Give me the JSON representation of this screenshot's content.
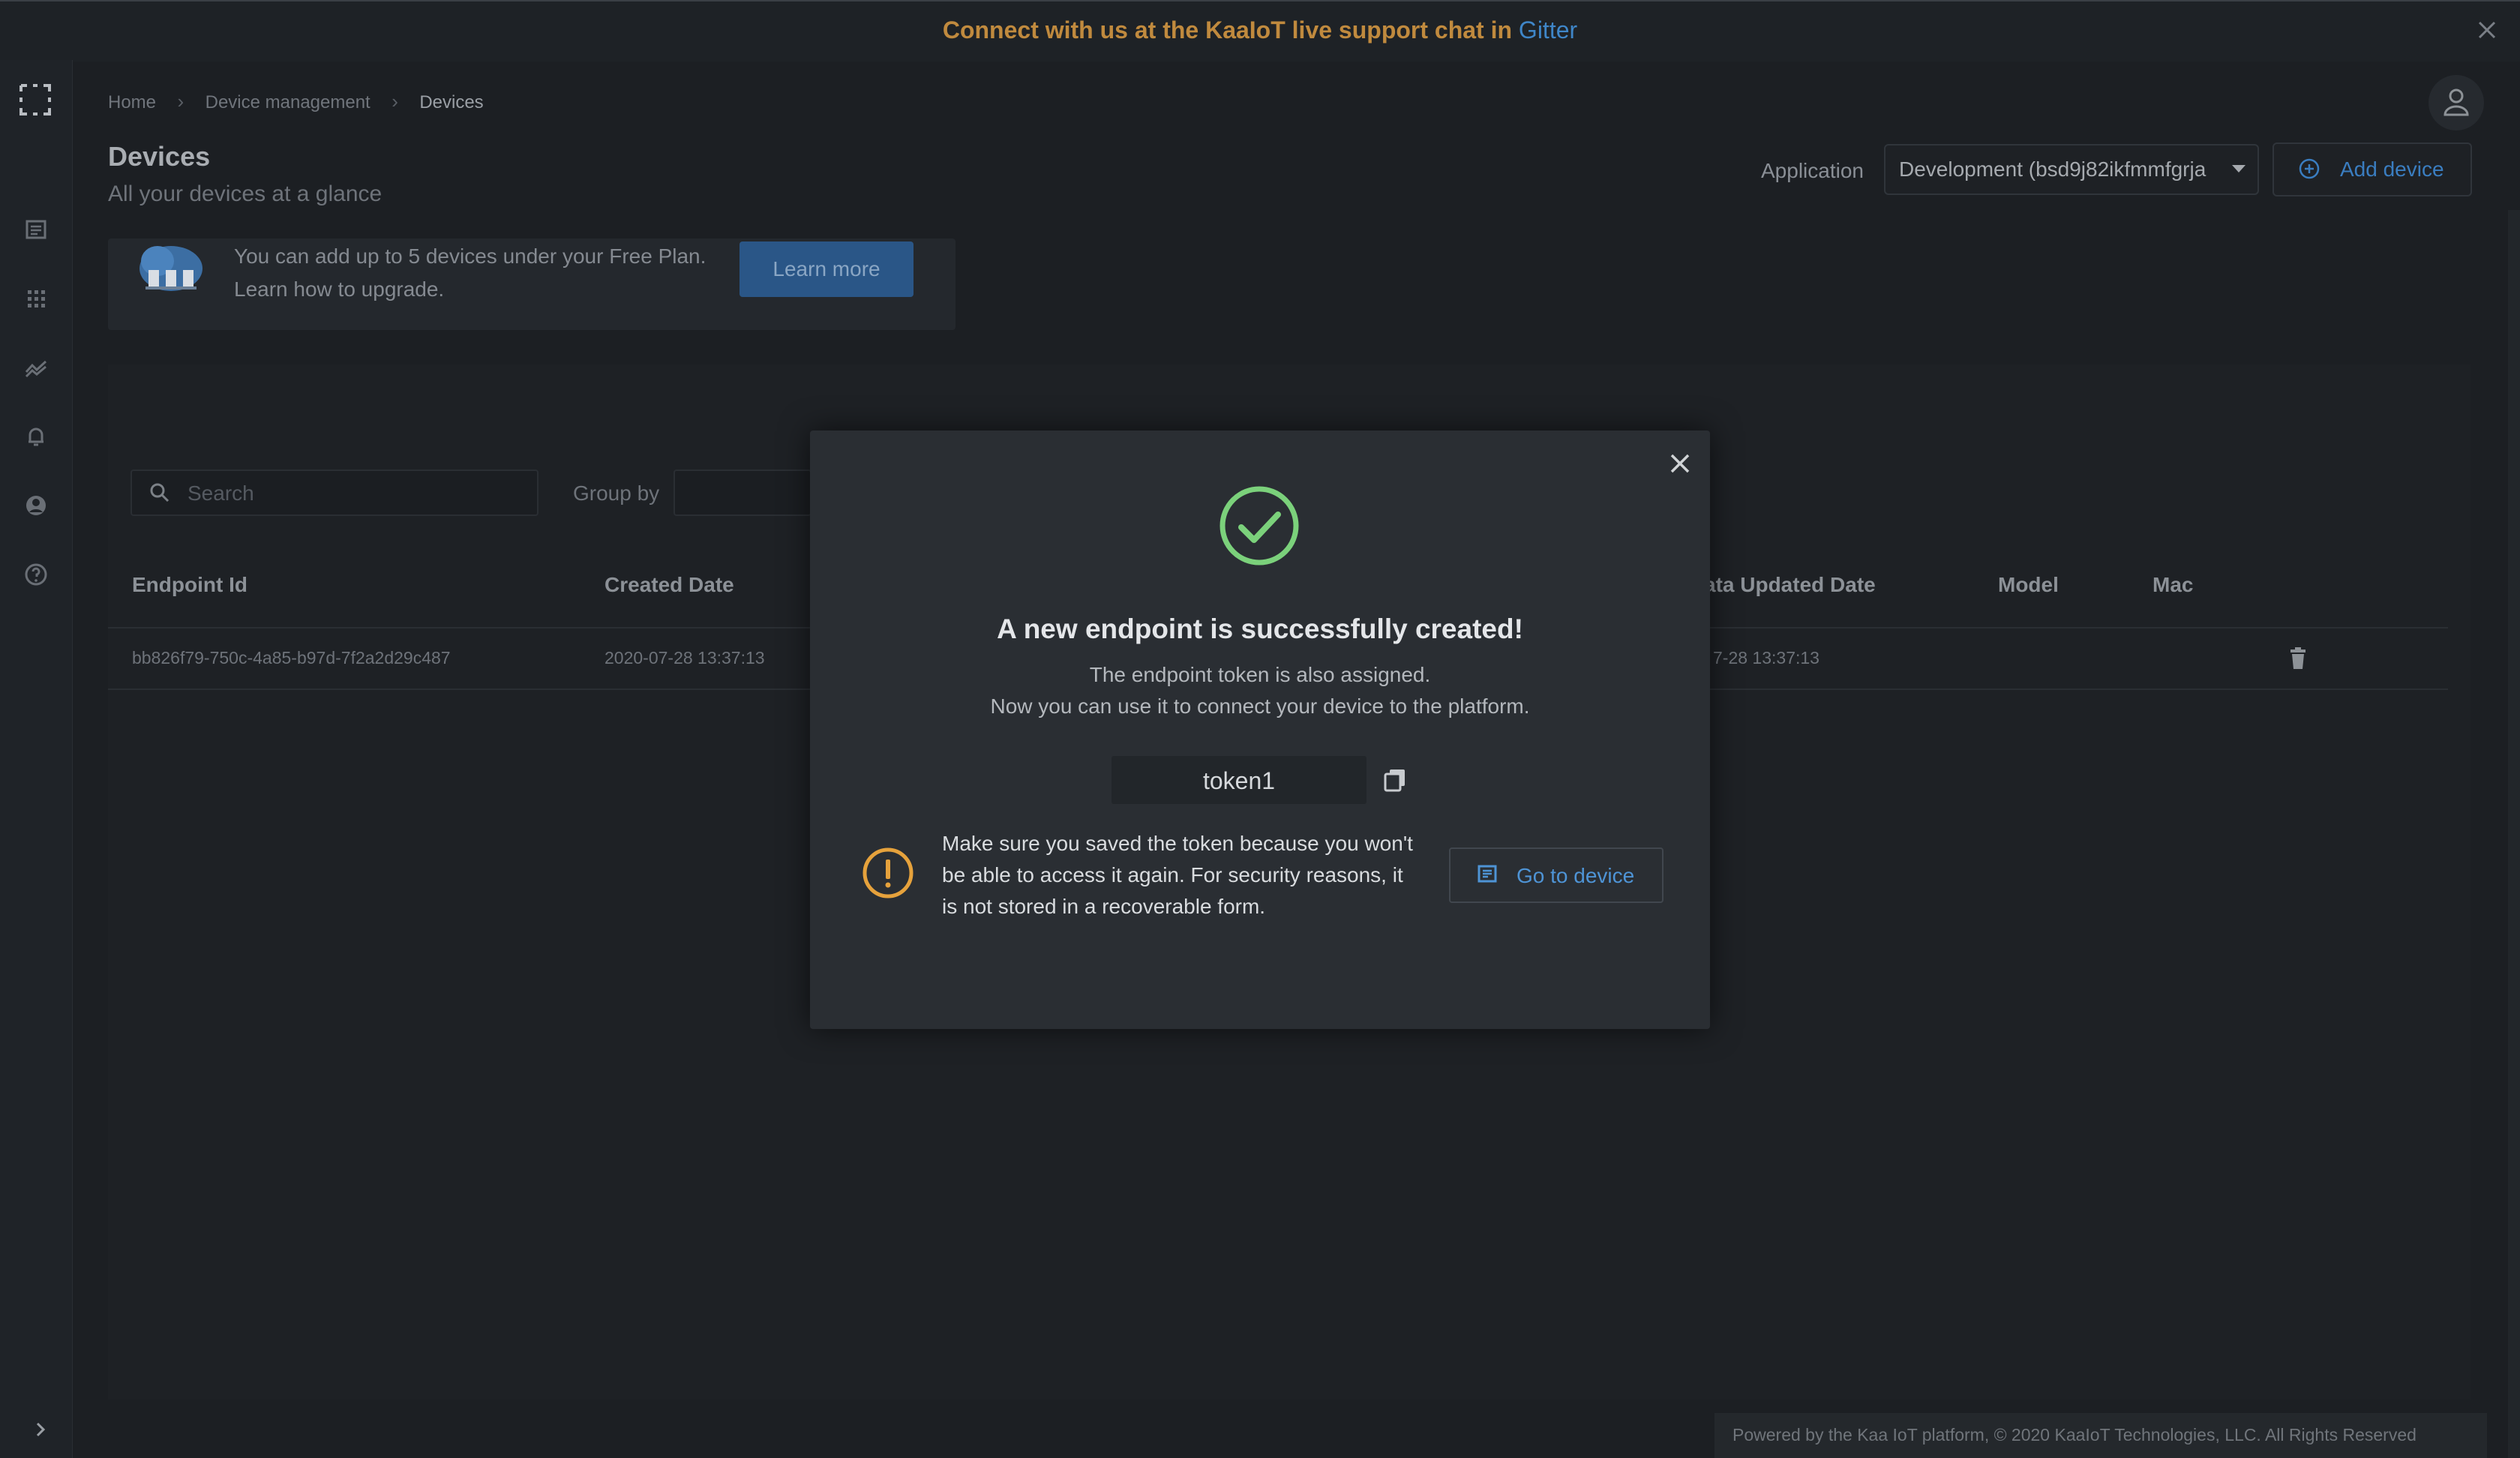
{
  "banner": {
    "text": "Connect with us at the KaaIoT live support chat in ",
    "link": "Gitter"
  },
  "breadcrumb": {
    "items": [
      "Home",
      "Device management",
      "Devices"
    ]
  },
  "header": {
    "title": "Devices",
    "subtitle": "All your devices at a glance",
    "application_label": "Application",
    "application_value": "Development (bsd9j82ikfmmfgrja",
    "add_device_label": "Add device"
  },
  "plan_card": {
    "line1": "You can add up to 5 devices under your Free Plan.",
    "line2": "Learn how to upgrade.",
    "learn_more_label": "Learn more"
  },
  "filters": {
    "search_placeholder": "Search",
    "group_by_label": "Group by"
  },
  "table": {
    "headers": [
      "Endpoint Id",
      "Created Date",
      "ata Updated Date",
      "Model",
      "Mac"
    ],
    "rows": [
      {
        "endpoint_id": "bb826f79-750c-4a85-b97d-7f2a2d29c487",
        "created": "2020-07-28 13:37:13",
        "updated": "7-28 13:37:13"
      }
    ]
  },
  "modal": {
    "title": "A new endpoint is successfully created!",
    "sub1": "The endpoint token is also assigned.",
    "sub2": "Now you can use it to connect your device to the platform.",
    "token": "token1",
    "warning": "Make sure you saved the token because you won't be able to access it again. For security reasons, it is not stored in a recoverable form.",
    "go_to_device_label": "Go to device"
  },
  "footer": {
    "text": "Powered by the Kaa IoT platform, © 2020 KaaIoT Technologies, LLC. All Rights Reserved"
  },
  "colors": {
    "accent": "#3f86c8",
    "success": "#7bd17b",
    "warning": "#e6a23c",
    "banner_text": "#c08a3e"
  },
  "icons": [
    "close-icon",
    "logo-icon",
    "dashboard-icon",
    "apps-icon",
    "analytics-icon",
    "bell-icon",
    "account-icon",
    "help-icon",
    "user-icon",
    "plus-circle-icon",
    "dropdown-arrow-icon",
    "cloud-devices-icon",
    "search-icon",
    "trash-icon",
    "check-circle-icon",
    "copy-icon",
    "warning-icon",
    "device-icon",
    "chevron-right-icon"
  ]
}
